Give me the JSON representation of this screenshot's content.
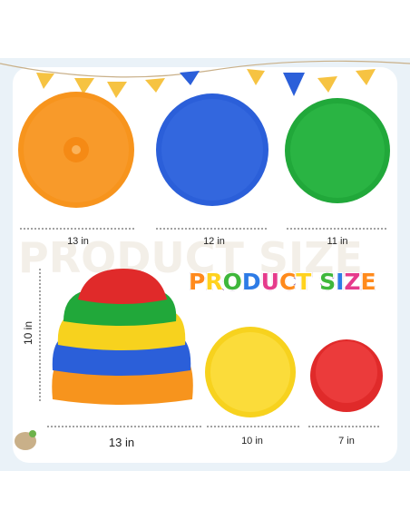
{
  "title": "PRODUCT SIZE",
  "title_colors": [
    "#ff8a1c",
    "#ffd21f",
    "#3fb73b",
    "#2d7be6",
    "#e63b8c",
    "#ff8a1c",
    "#ffd21f",
    "#3fb73b",
    "#2d7be6",
    "#e63b8c",
    "#ff8a1c",
    "#ffd21f"
  ],
  "dimensions": {
    "orange_disc": "13 in",
    "blue_disc": "12 in",
    "green_disc": "11 in",
    "stack_height": "10 in",
    "stack_width": "13 in",
    "yellow_disc": "10 in",
    "red_dome": "7 in"
  },
  "colors": {
    "orange": "#f7941d",
    "blue": "#2b5fd9",
    "green": "#21a83a",
    "yellow": "#f7d21e",
    "red": "#e02a2a",
    "bunting": [
      "#f6c342",
      "#3a7be0",
      "#f6c342",
      "#2b5fd9",
      "#f6c342"
    ]
  }
}
